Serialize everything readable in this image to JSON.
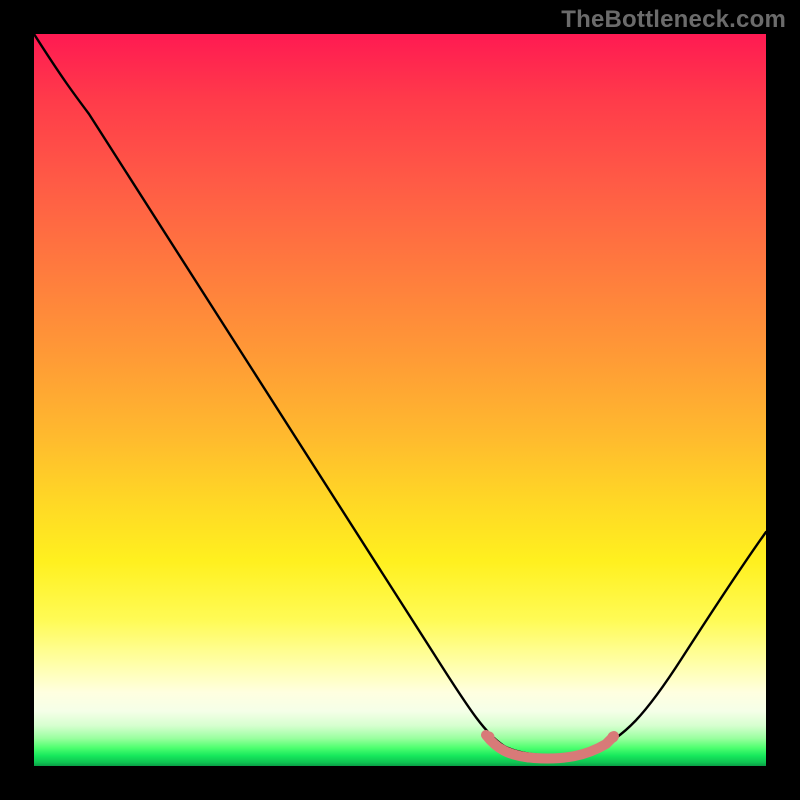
{
  "watermark": "TheBottleneck.com",
  "chart_data": {
    "type": "line",
    "title": "",
    "xlabel": "",
    "ylabel": "",
    "xlim": [
      0,
      100
    ],
    "ylim": [
      0,
      100
    ],
    "x": [
      0,
      6,
      16,
      28,
      40,
      52,
      60,
      64,
      68,
      73,
      77,
      80,
      88,
      100
    ],
    "values": [
      100,
      92,
      76,
      58,
      40,
      22,
      10,
      4,
      1,
      0.5,
      0.5,
      1,
      10,
      28
    ],
    "minimum_region": {
      "x_start": 63,
      "x_end": 79,
      "marker_color": "#e07878"
    },
    "background_gradient": {
      "top": "#ff1a52",
      "mid": "#ffe022",
      "bottom": "#0fc552"
    },
    "annotations": [],
    "grid": false,
    "legend": false
  }
}
